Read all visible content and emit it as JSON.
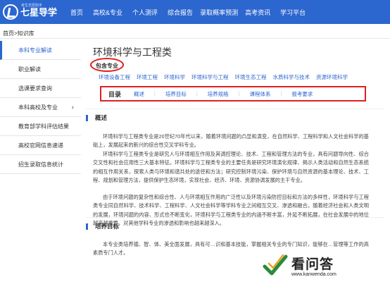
{
  "logo": {
    "text": "七星导学",
    "sub": "考生志愿助手"
  },
  "nav": [
    "首页",
    "高校&专业",
    "个人测评",
    "综合报告",
    "录取概率预测",
    "高考资讯",
    "学习平台"
  ],
  "breadcrumb": "首页>知识库",
  "sidebar": [
    {
      "label": "本科专业解读",
      "active": true
    },
    {
      "label": "职业解读"
    },
    {
      "label": "选课要求查询"
    },
    {
      "label": "本科高校及专业",
      "chevron": "›"
    },
    {
      "label": "教育部学科评估结果"
    },
    {
      "label": "高校官网信息速递"
    },
    {
      "label": "招生录取信息统计"
    }
  ],
  "main": {
    "title": "环境科学与工程类",
    "include_label": "包含专业",
    "sub_links": [
      "环境设备工程",
      "环境工程",
      "环境科学",
      "环境科学与工程",
      "环境生态工程",
      "水质科学与技术",
      "资源环境科学"
    ],
    "toc": {
      "title": "目录",
      "links": [
        "概述",
        "培养目标",
        "培养规格",
        "课程体系",
        "报考要求"
      ]
    },
    "sections": [
      {
        "heading": "概述",
        "paragraphs": [
          "环境科学与工程类专业是20世纪70年代以来，随着环境问题的凸显和演变，在自然科学、工程科学和人文社会科学的基础上，发展起来的新兴的综合性交叉学科专业。",
          "环境科学与工程类专业是研究人与环境相互作用及其调控理论、技术、工程和管理方法的专业，具有问题导向性、综合交叉性和社会应用性三大基本特征。环境科学与工程类专业的主要任务是研究环境演化规律、揭示人类活动和自然生态系统的相互作用关系，探索人类与环境和谐共处的途径和方法；研究控制环境污染、保护环境与自然资源的基本理论、技术、工程、规划和管理方法，提供保护生态环境，实现社会、经济、环境、资源协调发展的主干专业。",
          "由于环境问题的复杂性和综合性、人与环境相互作用的广泛性以及环境污染防控目标和方法的多样性，环境科学与工程类专业同自然科学、技术科学、工程科学、人文社会科学等学科专业之间相互交叉、渗透和融合。随着经济社会和人类文明的发展，环境问题的内容、形式也不断变化，环境科学与工程类专业的内涵不断丰富，外延不断拓展，在社会发展中的地位越来越重要，对其他学科专业的渗透和影响也越来越深入。"
        ]
      },
      {
        "heading": "培养目标",
        "paragraphs": [
          "本专业类培养德、智、体、美全面发展，具有可…识和基本技能，掌握相关专业的专门知识，能够在…管理等工作的高素质专门人才。"
        ]
      }
    ]
  },
  "watermark": {
    "text": "看问答",
    "url": "www.kanwenda.com"
  },
  "colors": {
    "brand": "#2c66cf",
    "highlight": "#e02020"
  }
}
